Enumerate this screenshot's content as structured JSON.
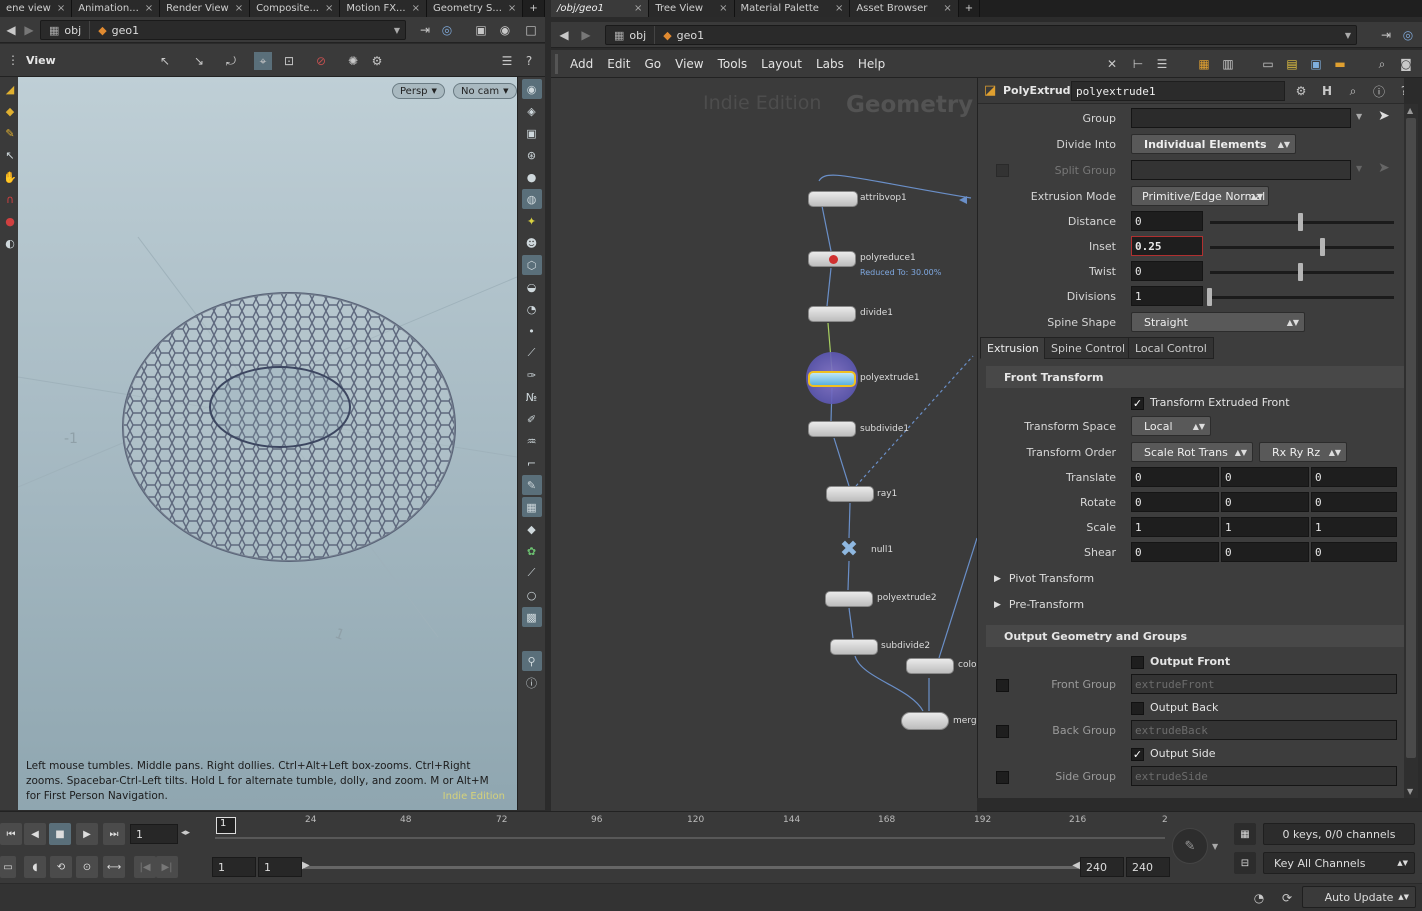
{
  "left_tabs": [
    {
      "label": "ene view"
    },
    {
      "label": "Animation..."
    },
    {
      "label": "Render View"
    },
    {
      "label": "Composite..."
    },
    {
      "label": "Motion FX..."
    },
    {
      "label": "Geometry S..."
    }
  ],
  "right_tabs": [
    {
      "label": "/obj/geo1"
    },
    {
      "label": "Tree View"
    },
    {
      "label": "Material Palette"
    },
    {
      "label": "Asset Browser"
    }
  ],
  "left_path": {
    "obj": "obj",
    "geo": "geo1"
  },
  "right_path": {
    "obj": "obj",
    "geo": "geo1"
  },
  "viewer": {
    "title": "View",
    "persp": "Persp",
    "cam": "No cam",
    "hint": "Left mouse tumbles. Middle pans. Right dollies. Ctrl+Alt+Left box-zooms. Ctrl+Right zooms. Spacebar-Ctrl-Left tilts. Hold L for alternate tumble, dolly, and zoom.    M or Alt+M for First Person Navigation.",
    "watermark": "Indie Edition"
  },
  "menu": [
    "Add",
    "Edit",
    "Go",
    "View",
    "Tools",
    "Layout",
    "Labs",
    "Help"
  ],
  "network": {
    "watermark_edition": "Indie Edition",
    "watermark_context": "Geometry",
    "nodes": [
      {
        "name": "attribvop1"
      },
      {
        "name": "polyreduce1",
        "note": "Reduced To: 30.00%"
      },
      {
        "name": "divide1"
      },
      {
        "name": "polyextrude1"
      },
      {
        "name": "subdivide1"
      },
      {
        "name": "ray1"
      },
      {
        "name": "null1"
      },
      {
        "name": "polyextrude2"
      },
      {
        "name": "subdivide2"
      },
      {
        "name": "colo"
      },
      {
        "name": "merg"
      }
    ]
  },
  "parms": {
    "node_type": "PolyExtrude",
    "node_name": "polyextrude1",
    "group_label": "Group",
    "group_value": "",
    "divide_into_label": "Divide Into",
    "divide_into": "Individual Elements",
    "split_group_label": "Split Group",
    "extrusion_mode_label": "Extrusion Mode",
    "extrusion_mode": "Primitive/Edge Normal",
    "distance_label": "Distance",
    "distance": "0",
    "inset_label": "Inset",
    "inset": "0.25",
    "twist_label": "Twist",
    "twist": "0",
    "divisions_label": "Divisions",
    "divisions": "1",
    "spine_shape_label": "Spine Shape",
    "spine_shape": "Straight",
    "tabs": [
      "Extrusion",
      "Spine Control",
      "Local Control"
    ],
    "front_transform": "Front Transform",
    "transform_extruded_front": "Transform Extruded Front",
    "transform_space_label": "Transform Space",
    "transform_space": "Local",
    "transform_order_label": "Transform Order",
    "transform_order": "Scale Rot Trans",
    "rot_order": "Rx Ry Rz",
    "translate_label": "Translate",
    "translate": [
      "0",
      "0",
      "0"
    ],
    "rotate_label": "Rotate",
    "rotate": [
      "0",
      "0",
      "0"
    ],
    "scale_label": "Scale",
    "scale": [
      "1",
      "1",
      "1"
    ],
    "shear_label": "Shear",
    "shear": [
      "0",
      "0",
      "0"
    ],
    "pivot_transform": "Pivot Transform",
    "pre_transform": "Pre-Transform",
    "output_section": "Output Geometry and Groups",
    "output_front": "Output Front",
    "front_group_label": "Front Group",
    "front_group": "extrudeFront",
    "output_back": "Output Back",
    "back_group_label": "Back Group",
    "back_group": "extrudeBack",
    "output_side": "Output Side",
    "side_group_label": "Side Group",
    "side_group": "extrudeSide"
  },
  "timeline": {
    "current_frame": "1",
    "frame_marker": "1",
    "ticks": [
      "24",
      "48",
      "72",
      "96",
      "120",
      "144",
      "168",
      "192",
      "216",
      "2"
    ],
    "range_start": "1",
    "range_start2": "1",
    "range_end": "240",
    "range_end2": "240",
    "keys_info": "0 keys, 0/0 channels",
    "key_all": "Key All Channels",
    "auto_update": "Auto Update"
  },
  "colors": {
    "accent": "#e0a030",
    "selected_node": "#f0c020",
    "wire": "#6a8fc8",
    "inset_border": "#b03030"
  }
}
